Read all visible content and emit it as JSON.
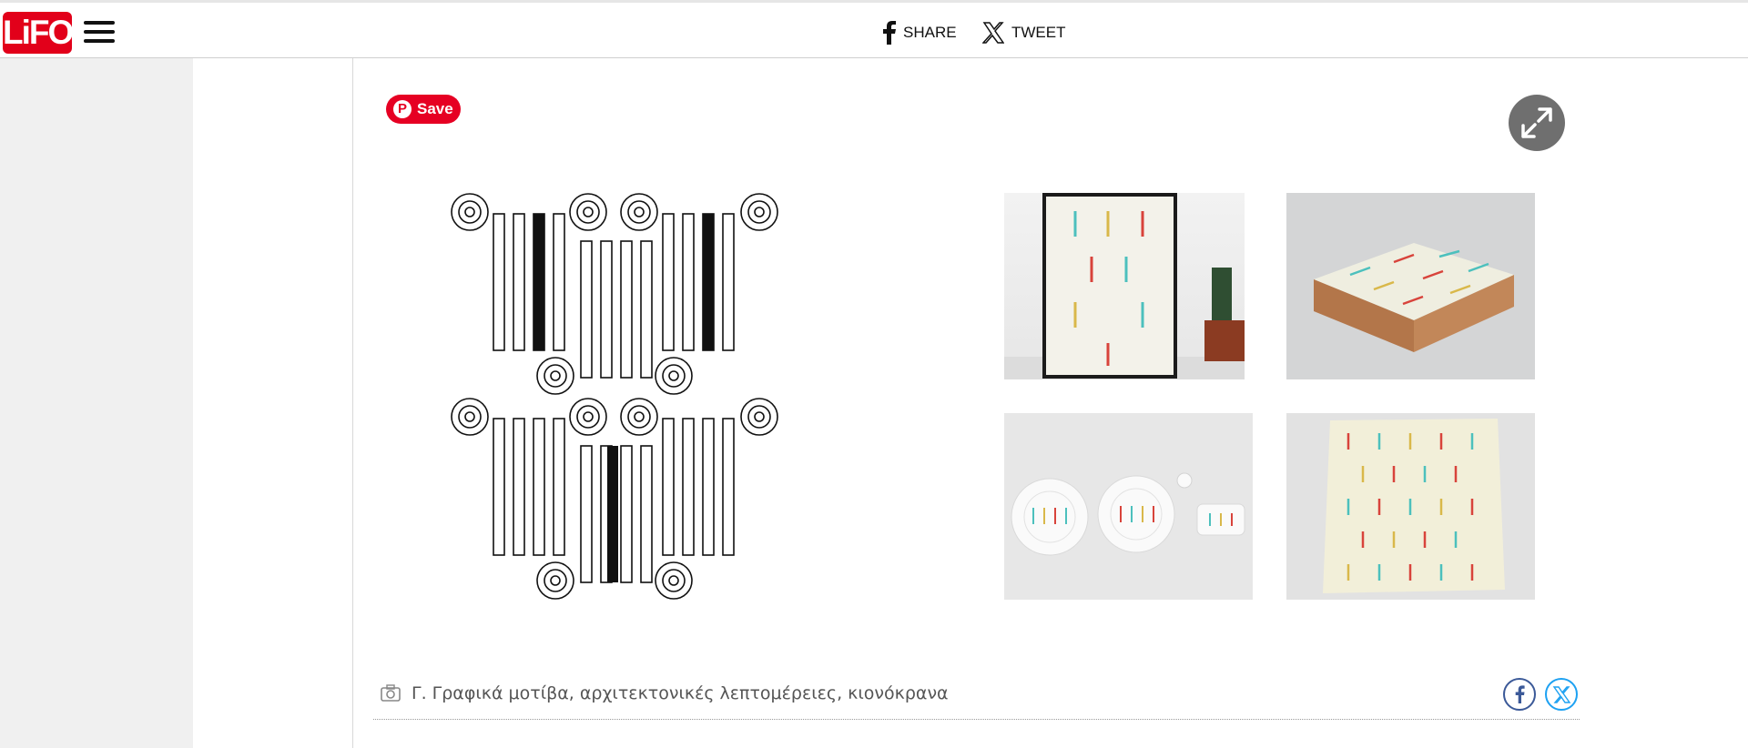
{
  "brand": {
    "logo_text": "LiFO",
    "color": "#e2001a"
  },
  "header": {
    "share_label": "SHARE",
    "tweet_label": "TWEET"
  },
  "gallery": {
    "pin_label": "Save",
    "caption": "Γ. Γραφικά μοτίβα, αρχιτεκτονικές λεπτομέρειες, κιονόκρανα"
  },
  "colors": {
    "pinterest": "#e60023",
    "facebook": "#3b5998",
    "twitter": "#1da1f2",
    "pattern_red": "#d8433b",
    "pattern_teal": "#4cc0bd",
    "pattern_yellow": "#d9b84a",
    "pattern_cream": "#f2efd9"
  }
}
